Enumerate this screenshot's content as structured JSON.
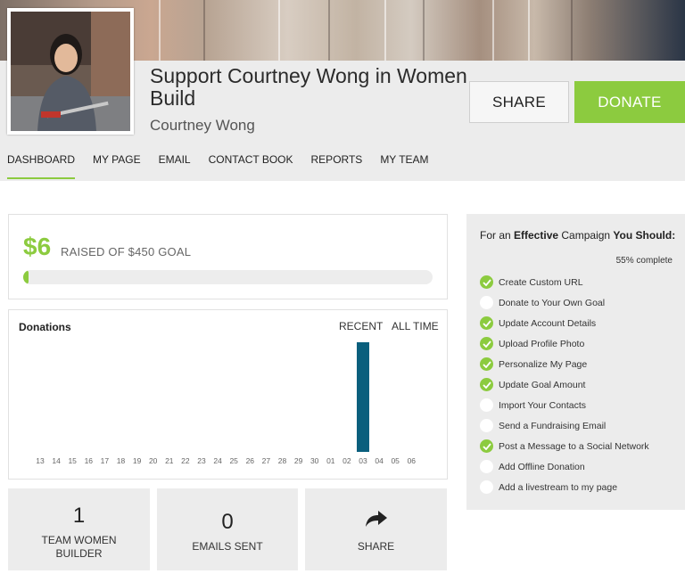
{
  "campaign": {
    "title": "Support Courtney Wong in Women Build",
    "owner": "Courtney Wong"
  },
  "actions": {
    "share_label": "SHARE",
    "donate_label": "DONATE"
  },
  "colors": {
    "accent": "#8ccb3f",
    "bar": "#0a5f7d",
    "panel": "#ececec"
  },
  "tabs": [
    {
      "label": "DASHBOARD",
      "active": true
    },
    {
      "label": "MY PAGE",
      "active": false
    },
    {
      "label": "EMAIL",
      "active": false
    },
    {
      "label": "CONTACT BOOK",
      "active": false
    },
    {
      "label": "REPORTS",
      "active": false
    },
    {
      "label": "MY TEAM",
      "active": false
    }
  ],
  "raised": {
    "amount": "$6",
    "goal_text": "RAISED OF $450 GOAL",
    "progress_fraction": 0.0133
  },
  "donations": {
    "title": "Donations",
    "filters": [
      "RECENT",
      "ALL TIME"
    ]
  },
  "chart_data": {
    "type": "bar",
    "title": "Donations",
    "categories": [
      "13",
      "14",
      "15",
      "16",
      "17",
      "18",
      "19",
      "20",
      "21",
      "22",
      "23",
      "24",
      "25",
      "26",
      "27",
      "28",
      "29",
      "30",
      "01",
      "02",
      "03",
      "04",
      "05",
      "06"
    ],
    "values": [
      0,
      0,
      0,
      0,
      0,
      0,
      0,
      0,
      0,
      0,
      0,
      0,
      0,
      0,
      0,
      0,
      0,
      0,
      0,
      0,
      6,
      0,
      0,
      0
    ],
    "ylim": [
      0,
      6
    ],
    "grid": false,
    "legend": "none"
  },
  "stats": [
    {
      "number": "1",
      "label": "TEAM WOMEN\nBUILDER",
      "icon": null
    },
    {
      "number": "0",
      "label": "EMAILS SENT",
      "icon": null
    },
    {
      "number": null,
      "label": "SHARE",
      "icon": "share-arrow-icon"
    }
  ],
  "checklist": {
    "heading_pre": "For an ",
    "heading_bold1": "Effective",
    "heading_mid": " Campaign ",
    "heading_bold2": "You Should:",
    "progress_text": "55% complete",
    "items": [
      {
        "label": "Create Custom URL",
        "done": true
      },
      {
        "label": "Donate to Your Own Goal",
        "done": false
      },
      {
        "label": "Update Account Details",
        "done": true
      },
      {
        "label": "Upload Profile Photo",
        "done": true
      },
      {
        "label": "Personalize My Page",
        "done": true
      },
      {
        "label": "Update Goal Amount",
        "done": true
      },
      {
        "label": "Import Your Contacts",
        "done": false
      },
      {
        "label": "Send a Fundraising Email",
        "done": false
      },
      {
        "label": "Post a Message to a Social Network",
        "done": true
      },
      {
        "label": "Add Offline Donation",
        "done": false
      },
      {
        "label": "Add a livestream to my page",
        "done": false
      }
    ]
  }
}
